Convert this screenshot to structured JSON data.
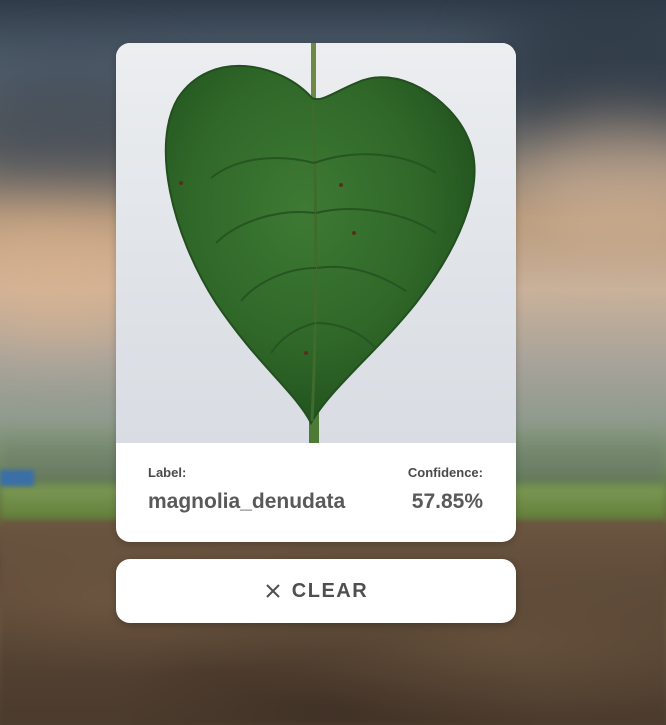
{
  "result": {
    "label_title": "Label:",
    "label_value": "magnolia_denudata",
    "confidence_title": "Confidence:",
    "confidence_value": "57.85%"
  },
  "actions": {
    "clear_label": "CLEAR",
    "clear_icon": "close-icon"
  },
  "colors": {
    "leaf": "#2f6a2a",
    "text": "#595959",
    "card": "#ffffff"
  }
}
